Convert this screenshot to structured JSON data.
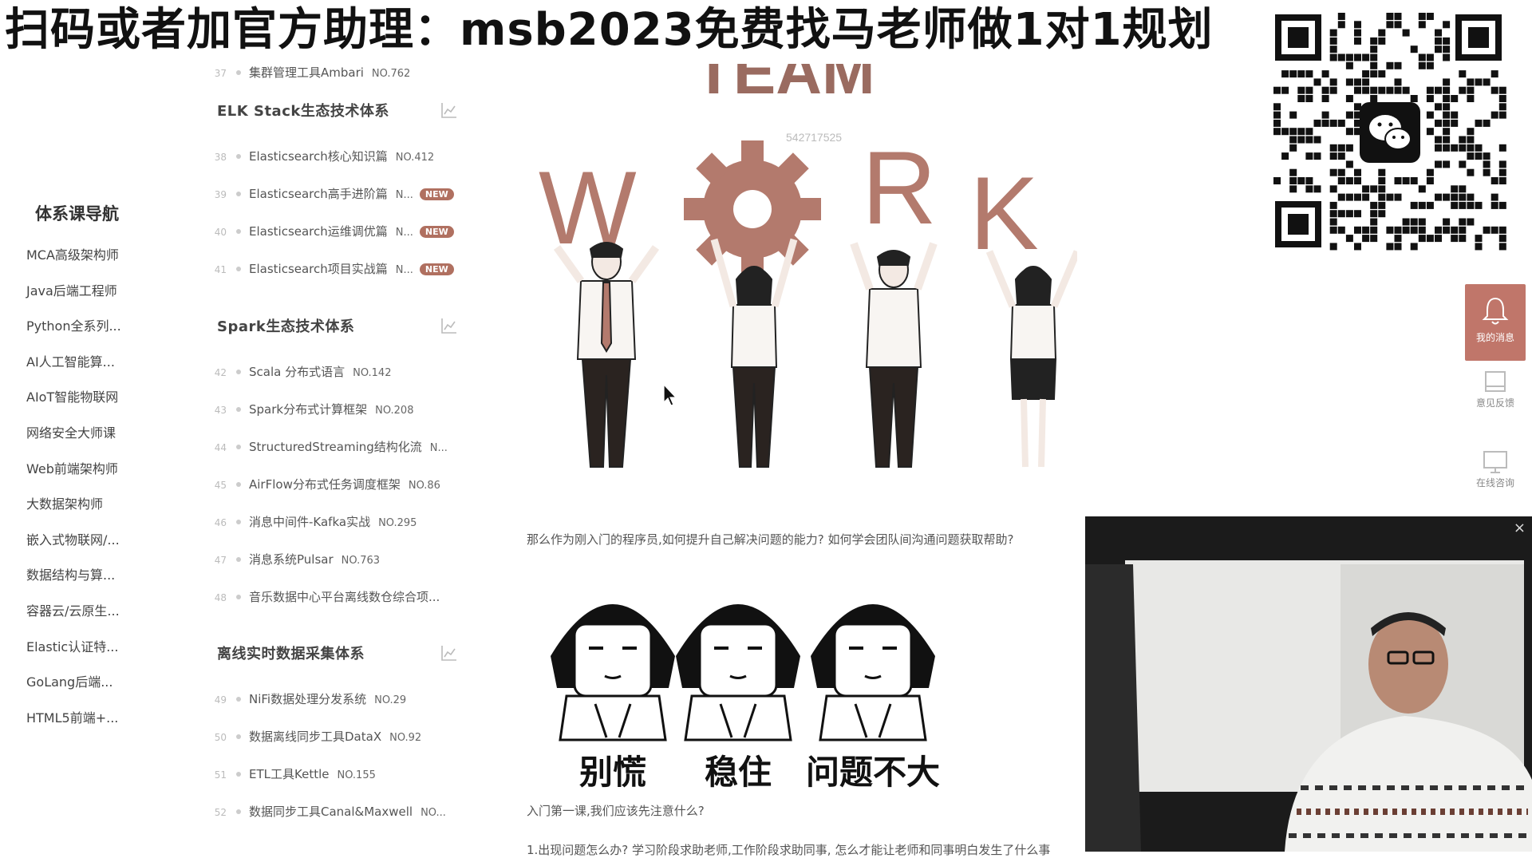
{
  "banner": {
    "text": "扫码或者加官方助理：msb2023免费找马老师做1对1规划"
  },
  "left_nav": {
    "title": "体系课导航",
    "items": [
      "MCA高级架构师",
      "Java后端工程师",
      "Python全系列...",
      "AI人工智能算...",
      "AIoT智能物联网",
      "网络安全大师课",
      "Web前端架构师",
      "大数据架构师",
      "嵌入式物联网/...",
      "数据结构与算...",
      "容器云/云原生...",
      "Elastic认证特...",
      "GoLang后端...",
      "HTML5前端+..."
    ]
  },
  "course_list": {
    "top_item": {
      "num": "37",
      "name": "集群管理工具Ambari",
      "no": "NO.762"
    },
    "sections": [
      {
        "title": "ELK Stack生态技术体系",
        "items": [
          {
            "num": "38",
            "name": "Elasticsearch核心知识篇",
            "no": "NO.412",
            "badge": ""
          },
          {
            "num": "39",
            "name": "Elasticsearch高手进阶篇",
            "no": "N...",
            "badge": "NEW"
          },
          {
            "num": "40",
            "name": "Elasticsearch运维调优篇",
            "no": "N...",
            "badge": "NEW"
          },
          {
            "num": "41",
            "name": "Elasticsearch项目实战篇",
            "no": "N...",
            "badge": "NEW"
          }
        ]
      },
      {
        "title": "Spark生态技术体系",
        "items": [
          {
            "num": "42",
            "name": "Scala 分布式语言",
            "no": "NO.142",
            "badge": ""
          },
          {
            "num": "43",
            "name": "Spark分布式计算框架",
            "no": "NO.208",
            "badge": ""
          },
          {
            "num": "44",
            "name": "StructuredStreaming结构化流",
            "no": "N...",
            "badge": ""
          },
          {
            "num": "45",
            "name": "AirFlow分布式任务调度框架",
            "no": "NO.86",
            "badge": ""
          },
          {
            "num": "46",
            "name": "消息中间件-Kafka实战",
            "no": "NO.295",
            "badge": ""
          },
          {
            "num": "47",
            "name": "消息系统Pulsar",
            "no": "NO.763",
            "badge": ""
          },
          {
            "num": "48",
            "name": "音乐数据中心平台离线数仓综合项...",
            "no": "",
            "badge": ""
          }
        ]
      },
      {
        "title": "离线实时数据采集体系",
        "items": [
          {
            "num": "49",
            "name": "NiFi数据处理分发系统",
            "no": "NO.29",
            "badge": ""
          },
          {
            "num": "50",
            "name": "数据离线同步工具DataX",
            "no": "NO.92",
            "badge": ""
          },
          {
            "num": "51",
            "name": "ETL工具Kettle",
            "no": "NO.155",
            "badge": ""
          },
          {
            "num": "52",
            "name": "数据同步工具Canal&Maxwell",
            "no": "NO...",
            "badge": ""
          }
        ]
      }
    ]
  },
  "article": {
    "image_team": "TEAM",
    "image_work": [
      "W",
      "R",
      "K"
    ],
    "watermark": "542717525",
    "question1": "那么作为刚入门的程序员,如何提升自己解决问题的能力? 如何学会团队间沟通问题获取帮助?",
    "meme_captions": [
      "别慌",
      "稳住",
      "问题不大"
    ],
    "question2": "入门第一课,我们应该先注意什么?",
    "question3": "1.出现问题怎么办? 学习阶段求助老师,工作阶段求助同事, 怎么才能让老师和同事明白发生了什么事"
  },
  "side_tools": [
    {
      "label": "我的消息",
      "icon": "bell-icon"
    },
    {
      "label": "意见反馈",
      "icon": "feedback-icon"
    },
    {
      "label": "在线咨询",
      "icon": "monitor-icon"
    }
  ],
  "video": {
    "close": "×"
  },
  "colors": {
    "accent": "#c0766a",
    "work": "#b37a6d",
    "badge": "#b07060"
  }
}
